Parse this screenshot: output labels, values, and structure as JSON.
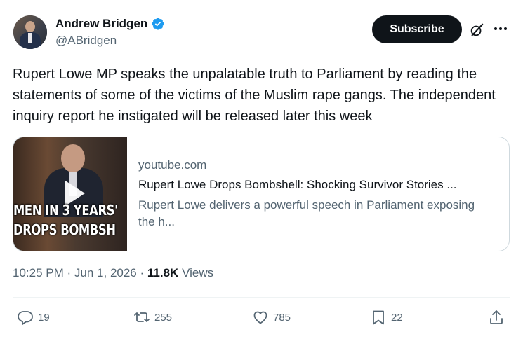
{
  "author": {
    "display_name": "Andrew Bridgen",
    "handle": "@ABridgen"
  },
  "header": {
    "subscribe_label": "Subscribe"
  },
  "tweet": {
    "text": "Rupert Lowe MP speaks the unpalatable truth to Parliament by reading the statements of some of the victims of the Muslim rape gangs. The independent inquiry report he instigated will be released later this week"
  },
  "card": {
    "domain": "youtube.com",
    "title": "Rupert Lowe Drops Bombshell: Shocking Survivor Stories ...",
    "description": "Rupert Lowe delivers a powerful speech in Parliament exposing the h...",
    "thumbnail_caption_line1": "MEN IN 3 YEARS'",
    "thumbnail_caption_line2": "DROPS BOMBSH"
  },
  "meta": {
    "time": "10:25 PM",
    "date": "Jun 1, 2026",
    "separator": "·",
    "views_count": "11.8K",
    "views_label": "Views"
  },
  "actions": {
    "replies": "19",
    "reposts": "255",
    "likes": "785",
    "bookmarks": "22"
  },
  "icons": {
    "verified": "verified-badge-icon",
    "grok": "grok-icon",
    "more": "more-icon",
    "reply": "reply-icon",
    "repost": "repost-icon",
    "like": "heart-icon",
    "bookmark": "bookmark-icon",
    "share": "share-icon",
    "play": "play-icon"
  },
  "colors": {
    "verified_blue": "#1d9bf0",
    "text_primary": "#0f1419",
    "text_secondary": "#536471",
    "border": "#cfd9de"
  }
}
